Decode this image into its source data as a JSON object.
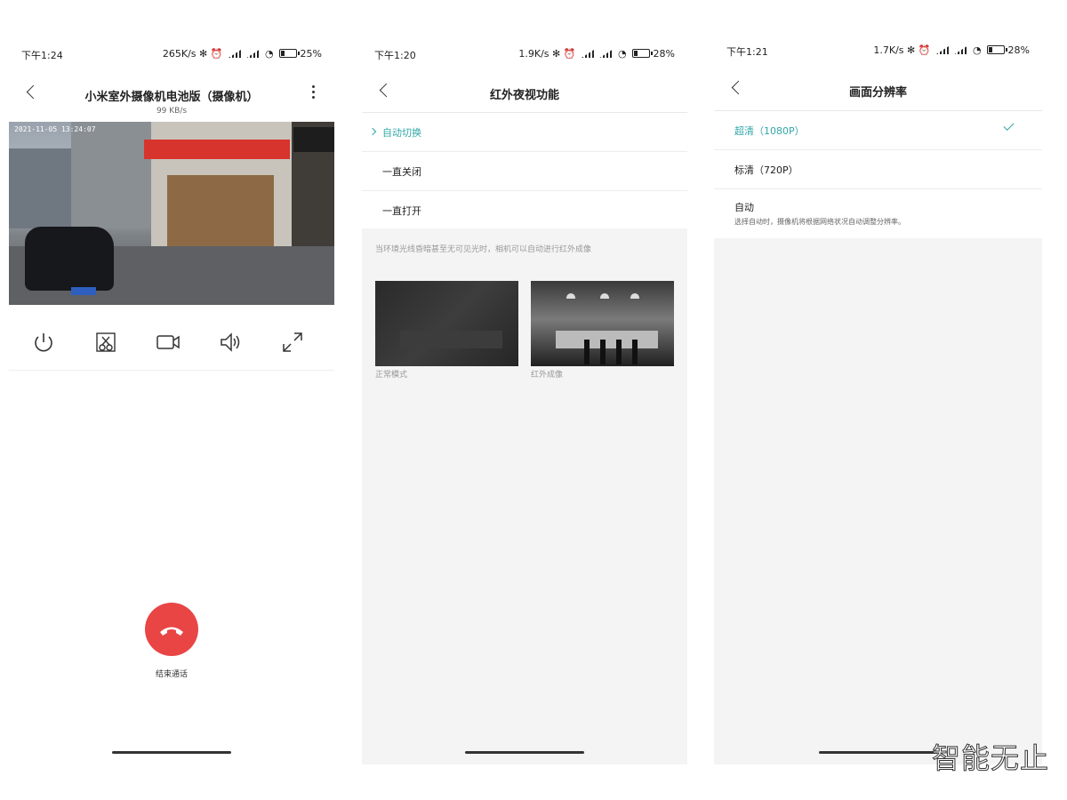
{
  "screen1": {
    "status": {
      "time": "下午1:24",
      "right": "265K/s ✻ ⏰",
      "battery": "25%"
    },
    "title": "小米室外摄像机电池版（摄像机）",
    "speed": "99 KB/s",
    "timestamp": "2021-11-05 13:24:07",
    "controls": [
      "power-icon",
      "screenshot-icon",
      "record-icon",
      "volume-icon",
      "fullscreen-icon"
    ],
    "hangup_label": "结束通话"
  },
  "screen2": {
    "status": {
      "time": "下午1:20",
      "right": "1.9K/s ✻ ⏰",
      "battery": "28%"
    },
    "title": "红外夜视功能",
    "options": [
      "自动切换",
      "一直关闭",
      "一直打开"
    ],
    "selected_index": 0,
    "note": "当环境光线昏暗甚至无可见光时，相机可以自动进行红外成像",
    "captions": [
      "正常模式",
      "红外成像"
    ]
  },
  "screen3": {
    "status": {
      "time": "下午1:21",
      "right": "1.7K/s ✻ ⏰",
      "battery": "28%"
    },
    "title": "画面分辨率",
    "options": [
      {
        "label": "超清（1080P）",
        "selected": true
      },
      {
        "label": "标清（720P）",
        "selected": false
      }
    ],
    "auto_label": "自动",
    "auto_desc": "选择自动时，摄像机将根据网络状况自动调整分辨率。"
  },
  "watermark": "智能无止",
  "colors": {
    "accent": "#32a7a8",
    "hangup": "#e94545"
  }
}
